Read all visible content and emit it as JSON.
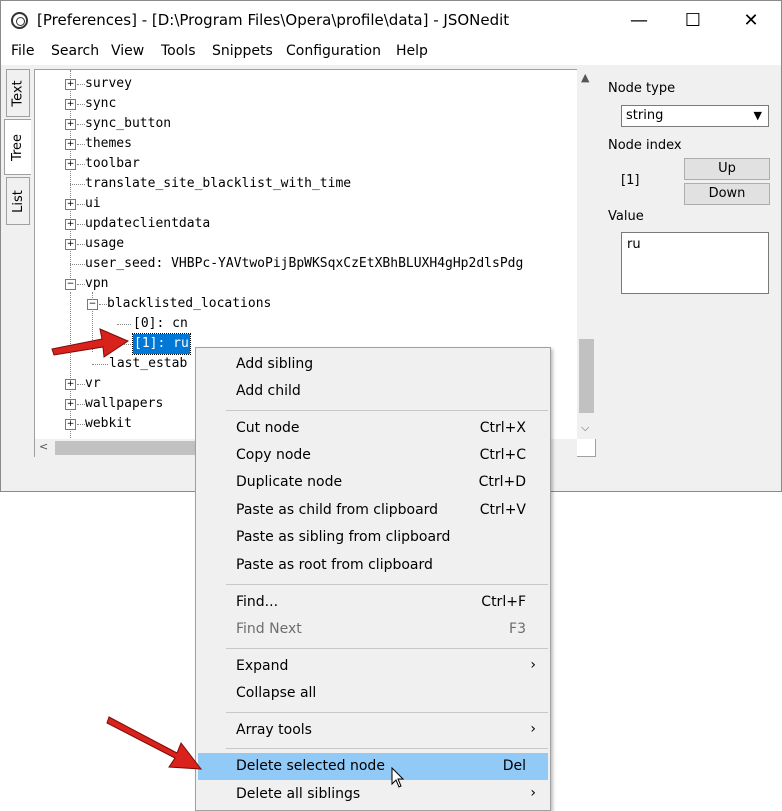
{
  "window": {
    "title": "[Preferences] - [D:\\Program Files\\Opera\\profile\\data] - JSONedit",
    "controls": {
      "minimize": "—",
      "maximize": "☐",
      "close": "✕"
    }
  },
  "menubar": [
    "File",
    "Search",
    "View",
    "Tools",
    "Snippets",
    "Configuration",
    "Help"
  ],
  "side_tabs": {
    "text": "Text",
    "tree": "Tree",
    "list": "List"
  },
  "tree": {
    "nodes": [
      {
        "label": "survey",
        "expander": "+"
      },
      {
        "label": "sync",
        "expander": "+"
      },
      {
        "label": "sync_button",
        "expander": "+"
      },
      {
        "label": "themes",
        "expander": "+"
      },
      {
        "label": "toolbar",
        "expander": "+"
      },
      {
        "label": "translate_site_blacklist_with_time"
      },
      {
        "label": "ui",
        "expander": "+"
      },
      {
        "label": "updateclientdata",
        "expander": "+"
      },
      {
        "label": "usage",
        "expander": "+"
      },
      {
        "label": "user_seed: VHBPc-YAVtwoPijBpWKSqxCzEtXBhBLUXH4gHp2dlsPdg"
      },
      {
        "label": "vpn",
        "expander": "−"
      },
      {
        "label": "blacklisted_locations",
        "expander": "−"
      },
      {
        "label": "[0]: cn"
      },
      {
        "label": "[1]: ru"
      },
      {
        "label": "last_estab"
      },
      {
        "label": "vr",
        "expander": "+"
      },
      {
        "label": "wallpapers",
        "expander": "+"
      },
      {
        "label": "webkit",
        "expander": "+"
      }
    ]
  },
  "scroll_arrows": {
    "up": "▲",
    "down": "⌵",
    "left": "<",
    "right": ">"
  },
  "right_panel": {
    "node_type_label": "Node type",
    "node_type_value": "string",
    "combo_arrow": "▼",
    "node_index_label": "Node index",
    "node_index_value": "[1]",
    "up_button": "Up",
    "down_button": "Down",
    "value_label": "Value",
    "value_text": "ru"
  },
  "context_menu": {
    "items": [
      {
        "label": "Add sibling",
        "shortcut": ""
      },
      {
        "label": "Add child",
        "shortcut": ""
      },
      {
        "label": "Cut node",
        "shortcut": "Ctrl+X"
      },
      {
        "label": "Copy node",
        "shortcut": "Ctrl+C"
      },
      {
        "label": "Duplicate node",
        "shortcut": "Ctrl+D"
      },
      {
        "label": "Paste as child from clipboard",
        "shortcut": "Ctrl+V"
      },
      {
        "label": "Paste as sibling from clipboard",
        "shortcut": ""
      },
      {
        "label": "Paste as root from clipboard",
        "shortcut": ""
      },
      {
        "label": "Find...",
        "shortcut": "Ctrl+F"
      },
      {
        "label": "Find Next",
        "shortcut": "F3",
        "disabled": true
      },
      {
        "label": "Expand",
        "submenu": "›"
      },
      {
        "label": "Collapse all"
      },
      {
        "label": "Array tools",
        "submenu": "›"
      },
      {
        "label": "Delete selected node",
        "shortcut": "Del",
        "highlighted": true
      },
      {
        "label": "Delete all siblings",
        "submenu": "›"
      }
    ]
  },
  "colors": {
    "selection": "#0078d7",
    "menu_highlight": "#91c9f7",
    "annotation_arrow": "#d9221c"
  }
}
